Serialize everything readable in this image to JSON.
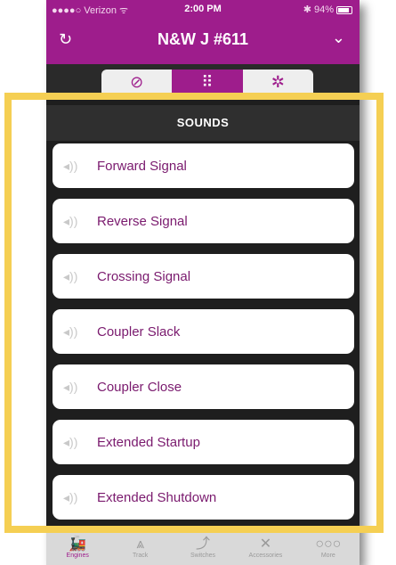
{
  "status_bar": {
    "carrier": "●●●●○ Verizon ᯤ",
    "time": "2:00 PM",
    "battery": "✱ 94%"
  },
  "nav": {
    "title": "N&W J #611",
    "refresh_icon": "↻",
    "chevron_icon": "⌄"
  },
  "segments": [
    {
      "icon": "speedometer-icon",
      "glyph": "⊘",
      "active": false
    },
    {
      "icon": "keypad-icon",
      "glyph": "⠿",
      "active": true
    },
    {
      "icon": "gear-icon",
      "glyph": "✲",
      "active": false
    }
  ],
  "section": {
    "title": "SOUNDS"
  },
  "sounds": [
    {
      "label": "Forward Signal",
      "icon": "speaker-icon",
      "glyph": "◂))"
    },
    {
      "label": "Reverse Signal",
      "icon": "speaker-icon",
      "glyph": "◂))"
    },
    {
      "label": "Crossing Signal",
      "icon": "speaker-icon",
      "glyph": "◂))"
    },
    {
      "label": "Coupler Slack",
      "icon": "speaker-icon",
      "glyph": "◂))"
    },
    {
      "label": "Coupler Close",
      "icon": "speaker-icon",
      "glyph": "◂))"
    },
    {
      "label": "Extended Startup",
      "icon": "speaker-icon",
      "glyph": "◂))"
    },
    {
      "label": "Extended Shutdown",
      "icon": "speaker-icon",
      "glyph": "◂))"
    }
  ],
  "tabs": [
    {
      "label": "Engines",
      "icon": "engine-icon",
      "glyph": "🚂",
      "active": true
    },
    {
      "label": "Track",
      "icon": "track-icon",
      "glyph": "⩓",
      "active": false
    },
    {
      "label": "Switches",
      "icon": "switch-icon",
      "glyph": "⤴",
      "active": false
    },
    {
      "label": "Accessories",
      "icon": "accessories-icon",
      "glyph": "✕",
      "active": false
    },
    {
      "label": "More",
      "icon": "more-icon",
      "glyph": "○○○",
      "active": false
    }
  ],
  "colors": {
    "accent": "#9e1d8c",
    "highlight": "#f5cf53",
    "background": "#1e1e1e"
  }
}
